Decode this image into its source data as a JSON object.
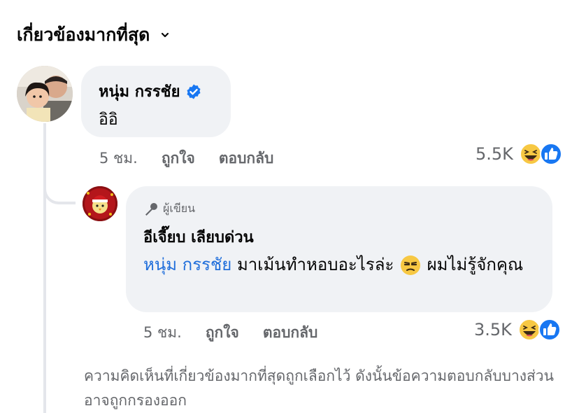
{
  "sort": {
    "label": "เกี่ยวข้องมากที่สุด"
  },
  "comment": {
    "author": "หนุ่ม กรรชัย",
    "text": "อิอิ",
    "time": "5 ชม.",
    "like_label": "ถูกใจ",
    "reply_label": "ตอบกลับ",
    "reaction_count": "5.5K",
    "reactions": [
      "haha-icon",
      "like-icon"
    ]
  },
  "reply": {
    "badge": "ผู้เขียน",
    "author": "อีเจี๊ยบ เลียบด่วน",
    "mention": "หนุ่ม กรรชัย",
    "text_before_emoji": " มาเม้นทำหอบอะไรล่ะ ",
    "text_after_emoji": " ผมไม่รู้จักคุณ",
    "time": "5 ชม.",
    "like_label": "ถูกใจ",
    "reply_label": "ตอบกลับ",
    "reaction_count": "3.5K",
    "reactions": [
      "haha-icon",
      "like-icon"
    ]
  },
  "notice": "ความคิดเห็นที่เกี่ยวข้องมากที่สุดถูกเลือกไว้ ดังนั้นข้อความตอบกลับบางส่วนอาจถูกกรองออก",
  "colors": {
    "mention": "#216fdb",
    "verified": "#1877f2",
    "bubble": "#f0f2f5",
    "meta": "#65676b"
  }
}
